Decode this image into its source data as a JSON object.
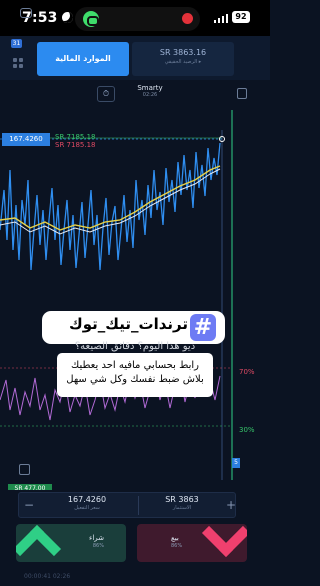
{
  "status_bar": {
    "time": "7:53",
    "battery": "92"
  },
  "header": {
    "account_badge": "31",
    "demo_label": "الموارد المالية",
    "real_value": "SR 3863.16",
    "real_label": "الرصيد الحقيقي ▸"
  },
  "toolbar": {
    "timer_glyph": "⏱",
    "asset_name": "Smarty",
    "asset_time": "02:26"
  },
  "chart": {
    "current_price": "167.4260",
    "sr_green": "SR 7185.18",
    "sr_red": "SR 7185.18",
    "level_70": "70%",
    "level_30": "30%",
    "scroll_badge": "5",
    "sr_bottom": "SR 477.00",
    "colors": {
      "price_line": "#2f8ef0",
      "ma_yellow": "#e8d24a",
      "ma_white": "#e9ecf2",
      "oscillator": "#b26ad6",
      "vertical_green": "#2fcf86"
    }
  },
  "overlay": {
    "hashtag_text": "ترندات_تيك_توك",
    "under_text": "ديو هذا اليوم؟ دقائق الصيغه؟",
    "caption_line1": "رابط بحسابي مافيه احد يعطيك",
    "caption_line2": "بلاش ضبط نفسك وكل شي سهل"
  },
  "trade": {
    "minus": "−",
    "plus": "+",
    "price_value": "167.4260",
    "price_label": "سعر التفعيل",
    "amount_value": "SR 3863",
    "amount_label": "الاستثمار",
    "buy_label": "شراء",
    "buy_pct": "86%",
    "sell_label": "بيع",
    "sell_pct": "86%",
    "footer": "00:00:41 02:26"
  }
}
